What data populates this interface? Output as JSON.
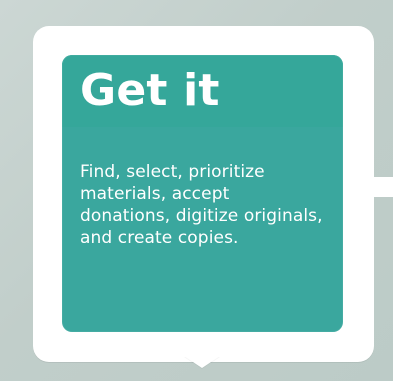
{
  "panel": {
    "title": "Get it",
    "description": "Find, select, prioritize materials, accept donations, digitize originals, and create copies."
  },
  "colors": {
    "background": "#c7d3cf",
    "card": "#ffffff",
    "panel": "#3aa79e",
    "text": "#ffffff"
  }
}
